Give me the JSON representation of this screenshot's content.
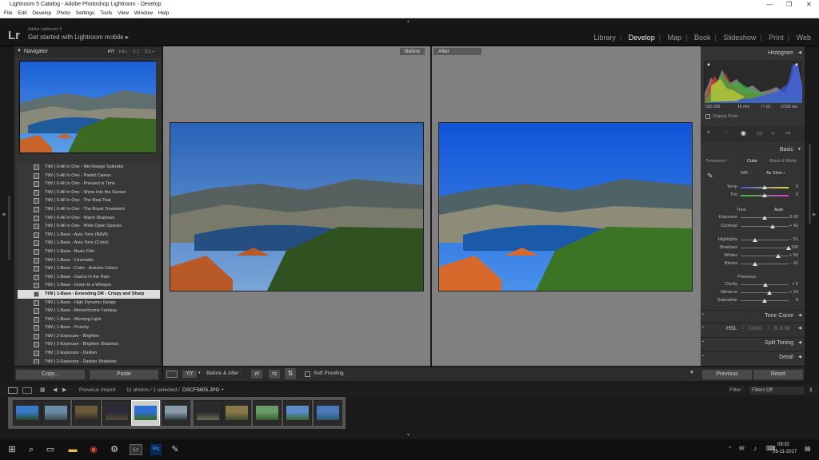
{
  "window": {
    "title": "Lightroom 5 Catalog - Adobe Photoshop Lightroom - Develop"
  },
  "menu": [
    "File",
    "Edit",
    "Develop",
    "Photo",
    "Settings",
    "Tools",
    "View",
    "Window",
    "Help"
  ],
  "identity": {
    "logo": "Lr",
    "app": "Adobe Lightroom 5",
    "mobile": "Get started with Lightroom mobile  ▸"
  },
  "modules": [
    "Library",
    "Develop",
    "Map",
    "Book",
    "Slideshow",
    "Print",
    "Web"
  ],
  "active_module": "Develop",
  "navigator": {
    "title": "Navigator",
    "zoom": [
      "FIT",
      "FILL",
      "1:1",
      "3:1 ÷"
    ]
  },
  "presets": [
    "TtW | 0-All In One - Mid-Range Splendor",
    "TtW | 0-All In One - Pastel Caress",
    "TtW | 0-All In One - Pressed in Time",
    "TtW | 0-All In One - Shine Into the Sunset",
    "TtW | 0-All In One - The Real Teal",
    "TtW | 0-All In One - The Royal Treatment",
    "TtW | 0-All In One - Warm Shadows",
    "TtW | 0-All In One - Wide Open Spaces",
    "TtW | 1-Base - Auto Tone (B&W)",
    "TtW | 1-Base - Auto Tone (Color)",
    "TtW | 1-Base - Basic Film",
    "TtW | 1-Base - Cinematic",
    "TtW | 1-Base - Color - Autumn Colors",
    "TtW | 1-Base - Dance In the Rain",
    "TtW | 1-Base - Down to a Whisper",
    "TtW | 1-Base - Extending DR - Crispy and Sharp",
    "TtW | 1-Base - High Dynamic Range",
    "TtW | 1-Base - Monochrome Fantasy",
    "TtW | 1-Base - Morning Light",
    "TtW | 1-Base - Punchy",
    "TtW | 2-Exposure - Brighten",
    "TtW | 2-Exposure - Brighten Shadows",
    "TtW | 2-Exposure - Darken",
    "TtW | 2-Exposure - Darken Shadows"
  ],
  "selected_preset_index": 15,
  "left_buttons": {
    "copy": "Copy...",
    "paste": "Paste"
  },
  "view": {
    "before": "Before",
    "after": "After"
  },
  "toolbar": {
    "yy": "Y|Y",
    "mode": "Before & After :",
    "soft_proofing": "Soft Proofing"
  },
  "histogram": {
    "title": "Histogram",
    "iso": "ISO 200",
    "focal": "16 mm",
    "aperture": "f / 16",
    "shutter": "1/160 sec",
    "original": "Original Photo"
  },
  "basic": {
    "title": "Basic",
    "treatment_label": "Treatment :",
    "color": "Color",
    "bw": "Black & White",
    "wb_label": "WB :",
    "wb_value": "As Shot ÷",
    "tone_label": "Tone",
    "auto": "Auto",
    "presence_label": "Presence",
    "sliders": [
      {
        "label": "Temp",
        "value": "0",
        "pos": 0.5
      },
      {
        "label": "Tint",
        "value": "0",
        "pos": 0.5
      },
      {
        "label": "Exposure",
        "value": "0.00",
        "pos": 0.5
      },
      {
        "label": "Contrast",
        "value": "+ 42",
        "pos": 0.66
      },
      {
        "label": "Highlights",
        "value": "- 51",
        "pos": 0.3
      },
      {
        "label": "Shadows",
        "value": "+ 100",
        "pos": 1.0
      },
      {
        "label": "Whites",
        "value": "+ 55",
        "pos": 0.78
      },
      {
        "label": "Blacks",
        "value": "- 42",
        "pos": 0.3
      },
      {
        "label": "Clarity",
        "value": "+ 5",
        "pos": 0.52
      },
      {
        "label": "Vibrance",
        "value": "+ 24",
        "pos": 0.6
      },
      {
        "label": "Saturation",
        "value": "0",
        "pos": 0.5
      }
    ]
  },
  "panels": {
    "tone_curve": "Tone Curve",
    "hsl": "HSL",
    "color": "Color",
    "bw": "B & W",
    "split": "Split Toning",
    "detail": "Detail"
  },
  "right_buttons": {
    "previous": "Previous",
    "reset": "Reset"
  },
  "filmstrip": {
    "source": "Previous Import",
    "count": "11 photos / 1 selected /",
    "file": "DSCF5805.JPG ÷",
    "filter_label": "Filter :",
    "filter_value": "Filters Off"
  },
  "taskbar": {
    "time": "09:32",
    "date": "26-11-2017"
  },
  "colors": {
    "sky": "#2f6fd0",
    "lake": "#1f5a9a",
    "hills": "#3a5a2a",
    "roof": "#c8642a"
  }
}
